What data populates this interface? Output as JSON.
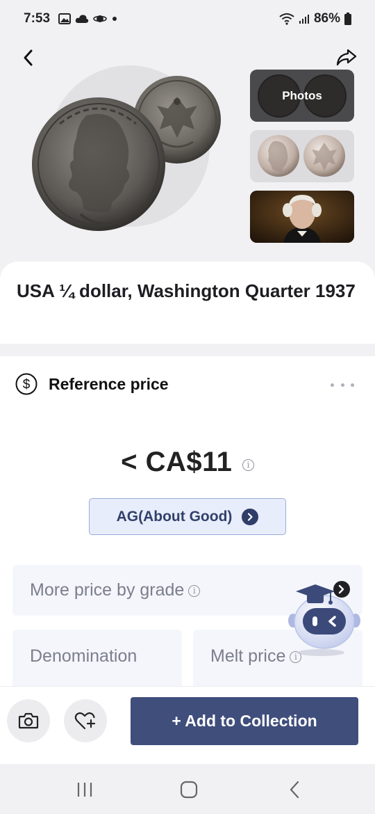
{
  "status_bar": {
    "time": "7:53",
    "battery": "86%",
    "left_icons": [
      "gallery-icon",
      "cloud-icon",
      "planet-icon",
      "dot-icon"
    ],
    "right_icons": [
      "wifi-icon",
      "signal-icon",
      "battery-icon"
    ]
  },
  "header": {
    "back_icon": "chevron-left-icon",
    "share_icon": "share-icon"
  },
  "gallery": {
    "photos_label": "Photos",
    "thumbnails": [
      "photos",
      "reference-coins",
      "washington-portrait"
    ]
  },
  "coin": {
    "title": "USA ¼ dollar, Washington Quarter 1937"
  },
  "reference_price": {
    "label": "Reference price",
    "value": "< CA$11",
    "grade_label": "AG(About Good)"
  },
  "cards": {
    "more_price_label": "More price by grade",
    "denomination_label": "Denomination",
    "melt_price_label": "Melt price"
  },
  "actions": {
    "add_to_collection": "+ Add to Collection"
  },
  "colors": {
    "primary": "#404e7c",
    "grade_bg": "#e8edfb",
    "grade_border": "#9aaad8",
    "card_bg": "#f4f6fb",
    "muted_text": "#7b7f8c"
  }
}
